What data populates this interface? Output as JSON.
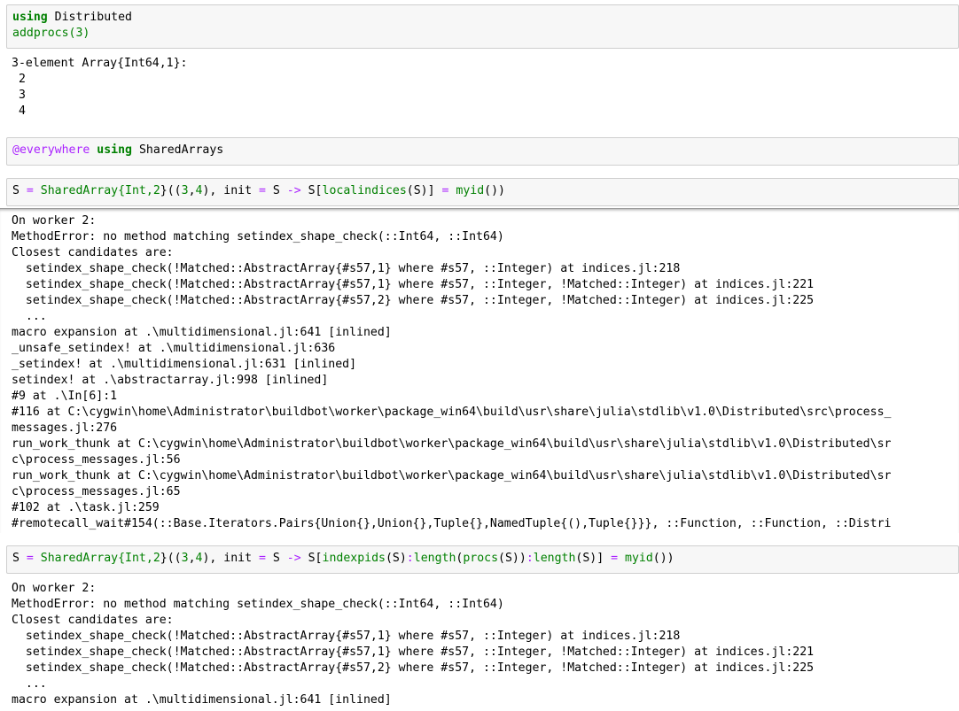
{
  "cells": [
    {
      "input": [
        [
          {
            "t": "using",
            "c": "kw"
          },
          {
            "t": " Distributed",
            "c": "plain"
          }
        ],
        [
          {
            "t": "addprocs(3)",
            "c": "num"
          }
        ]
      ],
      "output": [
        "3-element Array{Int64,1}:",
        " 2",
        " 3",
        " 4"
      ]
    },
    {
      "input": [
        [
          {
            "t": "@everywhere",
            "c": "macro"
          },
          {
            "t": " ",
            "c": "plain"
          },
          {
            "t": "using",
            "c": "kw"
          },
          {
            "t": " SharedArrays",
            "c": "plain"
          }
        ]
      ],
      "output": []
    },
    {
      "input": [
        [
          {
            "t": "S ",
            "c": "plain"
          },
          {
            "t": "=",
            "c": "op"
          },
          {
            "t": " SharedArray{Int,",
            "c": "num"
          },
          {
            "t": "2",
            "c": "num"
          },
          {
            "t": "}((",
            "c": "plain"
          },
          {
            "t": "3",
            "c": "num"
          },
          {
            "t": ",",
            "c": "plain"
          },
          {
            "t": "4",
            "c": "num"
          },
          {
            "t": "), init ",
            "c": "plain"
          },
          {
            "t": "=",
            "c": "op"
          },
          {
            "t": " S ",
            "c": "plain"
          },
          {
            "t": "->",
            "c": "op"
          },
          {
            "t": " S[",
            "c": "plain"
          },
          {
            "t": "localindices",
            "c": "num"
          },
          {
            "t": "(S)] ",
            "c": "plain"
          },
          {
            "t": "=",
            "c": "op"
          },
          {
            "t": " ",
            "c": "plain"
          },
          {
            "t": "myid",
            "c": "num"
          },
          {
            "t": "()",
            "c": "plain"
          },
          {
            "t": ")",
            "c": "plain"
          }
        ]
      ],
      "output": [
        "On worker 2:",
        "MethodError: no method matching setindex_shape_check(::Int64, ::Int64)",
        "Closest candidates are:",
        "  setindex_shape_check(!Matched::AbstractArray{#s57,1} where #s57, ::Integer) at indices.jl:218",
        "  setindex_shape_check(!Matched::AbstractArray{#s57,1} where #s57, ::Integer, !Matched::Integer) at indices.jl:221",
        "  setindex_shape_check(!Matched::AbstractArray{#s57,2} where #s57, ::Integer, !Matched::Integer) at indices.jl:225",
        "  ...",
        "macro expansion at .\\multidimensional.jl:641 [inlined]",
        "_unsafe_setindex! at .\\multidimensional.jl:636",
        "_setindex! at .\\multidimensional.jl:631 [inlined]",
        "setindex! at .\\abstractarray.jl:998 [inlined]",
        "#9 at .\\In[6]:1",
        "#116 at C:\\cygwin\\home\\Administrator\\buildbot\\worker\\package_win64\\build\\usr\\share\\julia\\stdlib\\v1.0\\Distributed\\src\\process_",
        "messages.jl:276",
        "run_work_thunk at C:\\cygwin\\home\\Administrator\\buildbot\\worker\\package_win64\\build\\usr\\share\\julia\\stdlib\\v1.0\\Distributed\\sr",
        "c\\process_messages.jl:56",
        "run_work_thunk at C:\\cygwin\\home\\Administrator\\buildbot\\worker\\package_win64\\build\\usr\\share\\julia\\stdlib\\v1.0\\Distributed\\sr",
        "c\\process_messages.jl:65",
        "#102 at .\\task.jl:259",
        "#remotecall_wait#154(::Base.Iterators.Pairs{Union{},Union{},Tuple{},NamedTuple{(),Tuple{}}}, ::Function, ::Function, ::Distri"
      ]
    },
    {
      "input": [
        [
          {
            "t": "S ",
            "c": "plain"
          },
          {
            "t": "=",
            "c": "op"
          },
          {
            "t": " SharedArray{Int,",
            "c": "num"
          },
          {
            "t": "2",
            "c": "num"
          },
          {
            "t": "}((",
            "c": "plain"
          },
          {
            "t": "3",
            "c": "num"
          },
          {
            "t": ",",
            "c": "plain"
          },
          {
            "t": "4",
            "c": "num"
          },
          {
            "t": "), init ",
            "c": "plain"
          },
          {
            "t": "=",
            "c": "op"
          },
          {
            "t": " S ",
            "c": "plain"
          },
          {
            "t": "->",
            "c": "op"
          },
          {
            "t": " S[",
            "c": "plain"
          },
          {
            "t": "indexpids",
            "c": "num"
          },
          {
            "t": "(S)",
            "c": "plain"
          },
          {
            "t": ":",
            "c": "op"
          },
          {
            "t": "length",
            "c": "num"
          },
          {
            "t": "(",
            "c": "plain"
          },
          {
            "t": "procs",
            "c": "num"
          },
          {
            "t": "(S))",
            "c": "plain"
          },
          {
            "t": ":",
            "c": "op"
          },
          {
            "t": "length",
            "c": "num"
          },
          {
            "t": "(S)] ",
            "c": "plain"
          },
          {
            "t": "=",
            "c": "op"
          },
          {
            "t": " ",
            "c": "plain"
          },
          {
            "t": "myid",
            "c": "num"
          },
          {
            "t": "())",
            "c": "plain"
          }
        ]
      ],
      "output": [
        "On worker 2:",
        "MethodError: no method matching setindex_shape_check(::Int64, ::Int64)",
        "Closest candidates are:",
        "  setindex_shape_check(!Matched::AbstractArray{#s57,1} where #s57, ::Integer) at indices.jl:218",
        "  setindex_shape_check(!Matched::AbstractArray{#s57,1} where #s57, ::Integer, !Matched::Integer) at indices.jl:221",
        "  setindex_shape_check(!Matched::AbstractArray{#s57,2} where #s57, ::Integer, !Matched::Integer) at indices.jl:225",
        "  ...",
        "macro expansion at .\\multidimensional.jl:641 [inlined]"
      ]
    }
  ]
}
